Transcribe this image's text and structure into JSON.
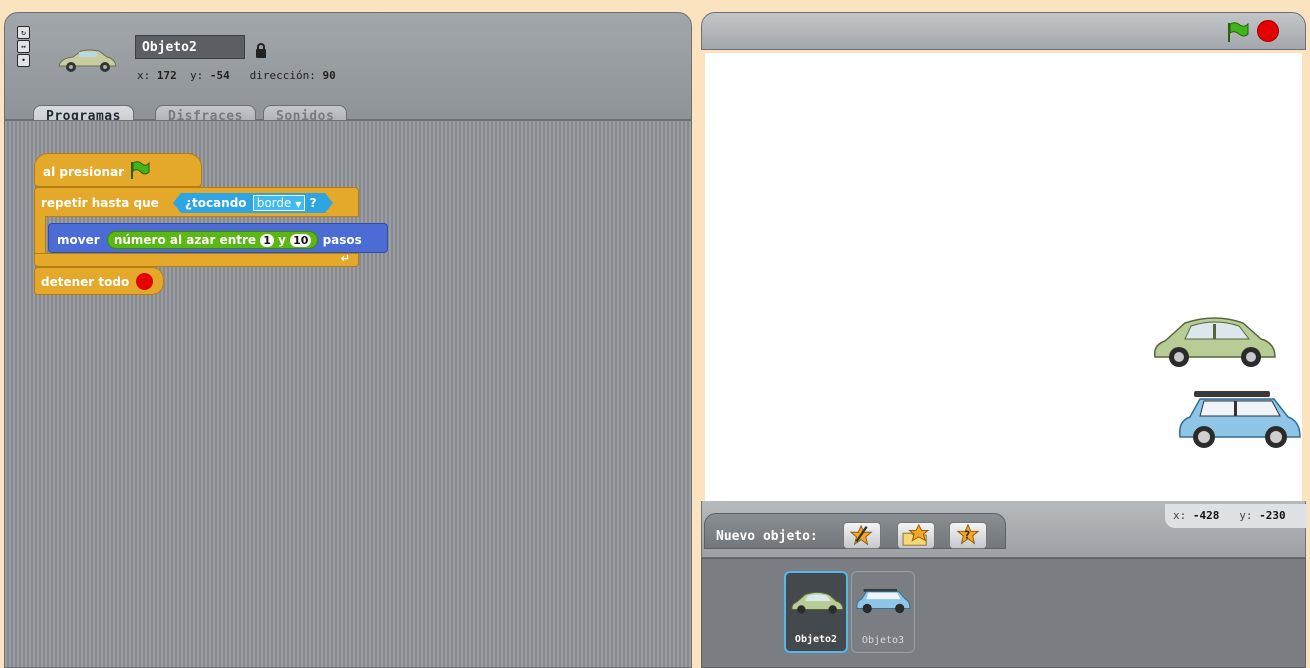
{
  "sprite_header": {
    "name": "Objeto2",
    "x_label": "x:",
    "x_value": "172",
    "y_label": "y:",
    "y_value": "-54",
    "direction_label": "dirección:",
    "direction_value": "90",
    "rotation_buttons": [
      "rotate-icon",
      "flip-left-right-icon",
      "no-rotate-icon"
    ]
  },
  "tabs": [
    {
      "label": "Programas",
      "active": true
    },
    {
      "label": "Disfraces",
      "active": false
    },
    {
      "label": "Sonidos",
      "active": false
    }
  ],
  "script": {
    "hat": "al presionar",
    "repeat_until": "repetir hasta que",
    "sensing_touching": "¿tocando",
    "touching_target": "borde",
    "sensing_end": "?",
    "move": "mover",
    "random_label": "número al azar entre",
    "random_from": "1",
    "random_and": "y",
    "random_to": "10",
    "steps": "pasos",
    "stop_all": "detener todo"
  },
  "stage": {
    "mouse_x_label": "x:",
    "mouse_x": "-428",
    "mouse_y_label": "y:",
    "mouse_y": "-230"
  },
  "new_sprite": {
    "label": "Nuevo objeto:",
    "buttons": [
      "paint-new-sprite-icon",
      "choose-sprite-file-icon",
      "random-sprite-icon"
    ]
  },
  "sprites": [
    {
      "name": "Objeto2",
      "selected": true
    },
    {
      "name": "Objeto3",
      "selected": false
    }
  ],
  "colors": {
    "control_block": "#e4a82b",
    "motion_block": "#4a6cd4",
    "operator_block": "#5cb712",
    "sensing_block": "#2ca5e2",
    "stop_red": "#e40000",
    "green_flag": "#3fb618"
  }
}
